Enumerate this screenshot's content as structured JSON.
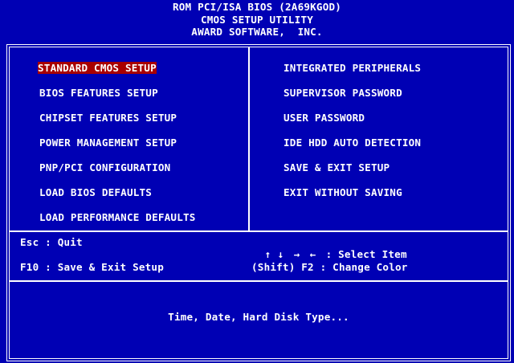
{
  "header": {
    "line1": "ROM PCI/ISA BIOS (2A69KGOD)",
    "line2": "CMOS SETUP UTILITY",
    "line3": "AWARD SOFTWARE,  INC."
  },
  "menu": {
    "left": [
      "STANDARD CMOS SETUP",
      "BIOS FEATURES SETUP",
      "CHIPSET FEATURES SETUP",
      "POWER MANAGEMENT SETUP",
      "PNP/PCI CONFIGURATION",
      "LOAD BIOS DEFAULTS",
      "LOAD PERFORMANCE DEFAULTS"
    ],
    "right": [
      "INTEGRATED PERIPHERALS",
      "SUPERVISOR PASSWORD",
      "USER PASSWORD",
      "IDE HDD AUTO DETECTION",
      "SAVE & EXIT SETUP",
      "EXIT WITHOUT SAVING"
    ],
    "selected": "STANDARD CMOS SETUP"
  },
  "hints": {
    "esc": "Esc : Quit",
    "f10": "F10 : Save & Exit Setup",
    "arrow_up": "↑",
    "arrow_down": "↓",
    "arrow_right": "→",
    "arrow_left": "←",
    "select_item": ": Select Item",
    "shift_f2": "(Shift) F2 : Change Color"
  },
  "status": "Time, Date, Hard Disk Type...",
  "colors": {
    "background": "#0000b4",
    "text": "#ffffff",
    "highlight": "#a80000"
  }
}
